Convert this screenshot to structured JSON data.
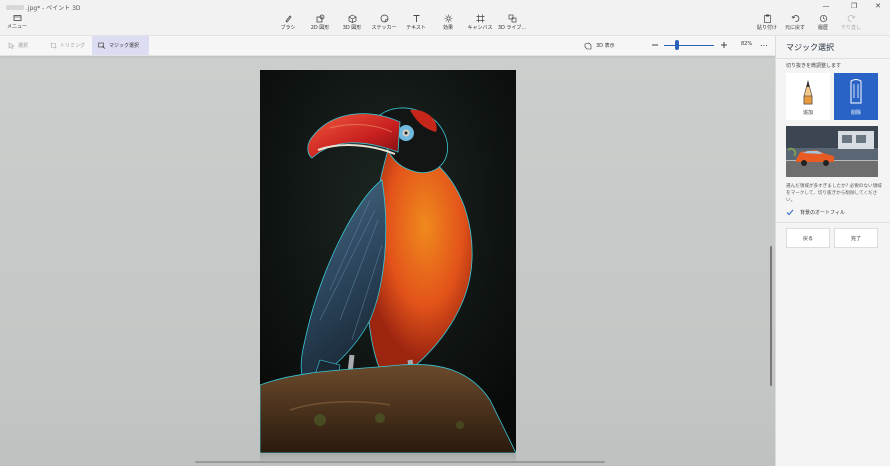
{
  "window": {
    "title_suffix": ".jpg* - ペイント 3D",
    "controls": {
      "minimize": "—",
      "maximize": "❐",
      "close": "✕"
    }
  },
  "menu": {
    "label": "メニュー",
    "icon": "menu-folder-icon"
  },
  "ribbon": {
    "items": [
      {
        "label": "ブラシ",
        "icon": "brush-icon"
      },
      {
        "label": "2D 図形",
        "icon": "2d-shapes-icon"
      },
      {
        "label": "3D 図形",
        "icon": "3d-shapes-icon"
      },
      {
        "label": "ステッカー",
        "icon": "sticker-icon"
      },
      {
        "label": "テキスト",
        "icon": "text-icon"
      },
      {
        "label": "効果",
        "icon": "effects-icon"
      },
      {
        "label": "キャンバス",
        "icon": "canvas-icon"
      },
      {
        "label": "3D ライブ...",
        "icon": "3d-library-icon"
      }
    ],
    "right": [
      {
        "label": "貼り付け",
        "icon": "paste-icon"
      },
      {
        "label": "元に戻す",
        "icon": "undo-icon"
      },
      {
        "label": "履歴",
        "icon": "history-icon"
      },
      {
        "label": "やり直し",
        "icon": "redo-icon"
      }
    ]
  },
  "toolbar": {
    "select": "選択",
    "crop": "トリミング",
    "magic_select": "マジック選択",
    "view3d": "3D 表示",
    "zoom": "82%",
    "more": "..."
  },
  "panel": {
    "title": "マジック選択",
    "subtitle": "切り抜きを微調整します",
    "mode_add": "追加",
    "mode_remove": "削除",
    "help": "選んだ領域が多すぎましたか? 必要のない領域をマークして、切り抜きから削除してください。",
    "autofill": "背景のオートフィル",
    "back": "戻る",
    "done": "完了"
  },
  "colors": {
    "accent": "#2a63c6",
    "selection_outline": "#38c7d6"
  }
}
